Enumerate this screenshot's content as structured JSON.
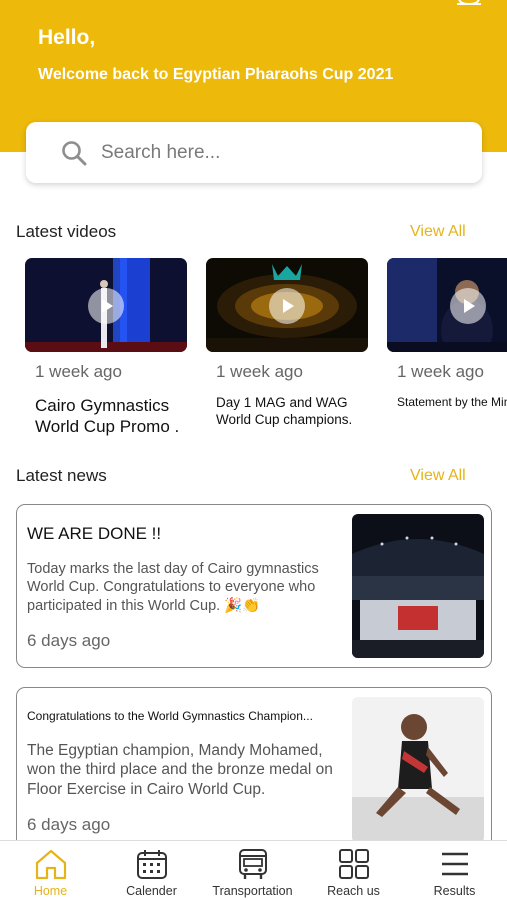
{
  "header": {
    "greeting": "Hello,",
    "welcome": "Welcome back to Egyptian Pharaohs Cup 2021",
    "background_color": "#EDB90B",
    "top_right_icon": "bell-icon"
  },
  "search": {
    "placeholder": "Search here...",
    "value": ""
  },
  "latest_videos": {
    "title": "Latest videos",
    "view_all_label": "View All",
    "items": [
      {
        "time": "1 week ago",
        "title": "Cairo Gymnastics World Cup Promo ."
      },
      {
        "time": "1 week ago",
        "title": "Day 1 MAG and WAG World Cup champions."
      },
      {
        "time": "1 week ago",
        "title": "Statement by the Minister of Youth a"
      }
    ]
  },
  "latest_news": {
    "title": "Latest news",
    "view_all_label": "View All",
    "items": [
      {
        "title": "WE ARE DONE !!",
        "body": "Today marks the last day of Cairo gymnastics World Cup. Congratulations to everyone who participated in this World Cup. 🎉👏",
        "time": "6 days ago"
      },
      {
        "title": "Congratulations to the World Gymnastics Champion...",
        "body": "The Egyptian champion, Mandy Mohamed, won the third place and the bronze medal on Floor Exercise in Cairo World Cup.",
        "time": "6 days ago"
      }
    ]
  },
  "tabbar": {
    "active_color": "#E6B318",
    "items": [
      {
        "label": "Home",
        "icon": "home-icon",
        "active": true
      },
      {
        "label": "Calender",
        "icon": "calendar-icon",
        "active": false
      },
      {
        "label": "Transportation",
        "icon": "bus-icon",
        "active": false
      },
      {
        "label": "Reach us",
        "icon": "grid-icon",
        "active": false
      },
      {
        "label": "Results",
        "icon": "menu-icon",
        "active": false
      }
    ]
  }
}
